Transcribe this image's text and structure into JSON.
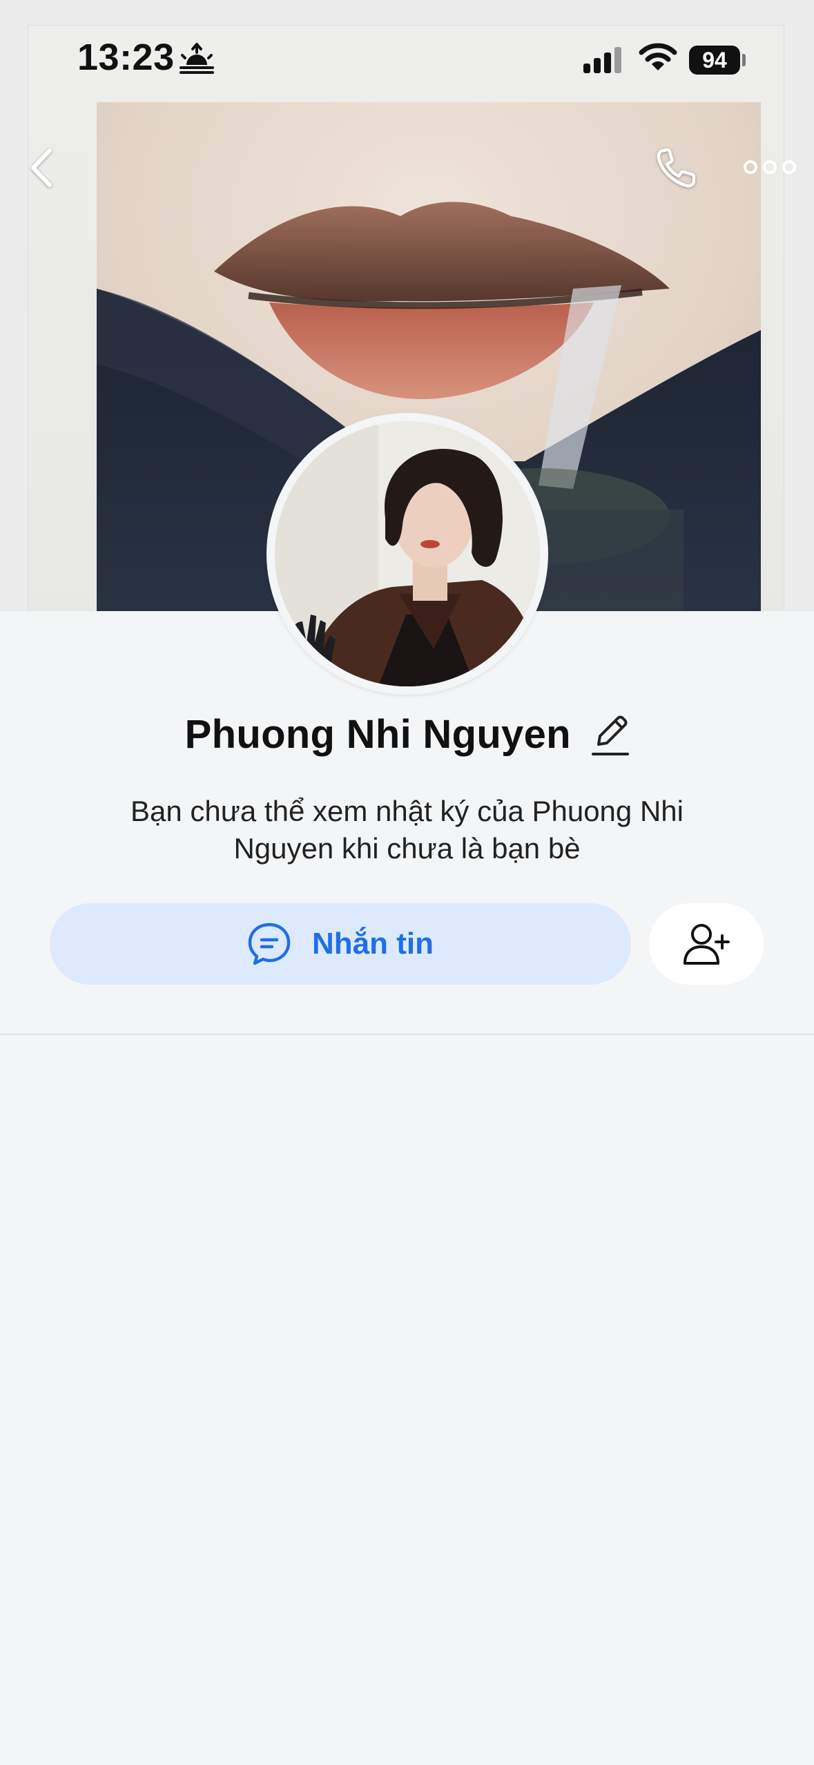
{
  "status_bar": {
    "time": "13:23",
    "battery": "94",
    "icons": [
      "sunrise-icon",
      "cellular-signal-icon",
      "wifi-icon",
      "battery-icon"
    ]
  },
  "nav": {
    "icons": [
      "back-chevron-icon",
      "phone-icon",
      "more-dots-icon"
    ]
  },
  "profile": {
    "name": "Phuong Nhi Nguyen",
    "privacy_note": "Bạn chưa thể xem nhật ký của Phuong Nhi Nguyen khi chưa là bạn bè"
  },
  "actions": {
    "message_label": "Nhắn tin",
    "message_icon": "chat-bubble-icon",
    "add_friend_icon": "add-user-icon"
  },
  "colors": {
    "background": "#f4f5f7",
    "message_button_bg": "#dde9fd",
    "accent": "#1f6fe5"
  }
}
